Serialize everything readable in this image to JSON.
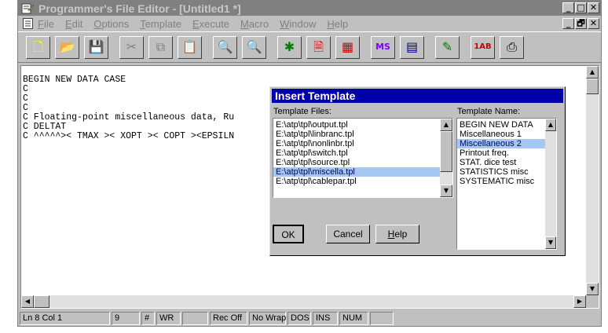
{
  "window": {
    "title": "Programmer's File Editor - [Untitled1 *]",
    "caption_buttons": [
      "_",
      "□",
      "✕"
    ],
    "mdi_buttons": [
      "_",
      "🗗",
      "✕"
    ]
  },
  "menu": [
    "File",
    "Edit",
    "Options",
    "Template",
    "Execute",
    "Macro",
    "Window",
    "Help"
  ],
  "toolbar": [
    {
      "icon": "new-file-icon",
      "glyph": "🗋",
      "color": "#ffff00"
    },
    {
      "icon": "open-folder-icon",
      "glyph": "📂",
      "color": "#ffcc00"
    },
    {
      "icon": "save-icon",
      "glyph": "💾",
      "color": "#cc0000"
    },
    {
      "icon": "cut-icon",
      "glyph": "✂",
      "color": "#808080"
    },
    {
      "icon": "copy-icon",
      "glyph": "⧉",
      "color": "#808080"
    },
    {
      "icon": "paste-icon",
      "glyph": "📋",
      "color": "#808080"
    },
    {
      "icon": "find-icon",
      "glyph": "🔍",
      "color": "#000000"
    },
    {
      "icon": "find-next-icon",
      "glyph": "🔍",
      "color": "#cc0000"
    },
    {
      "icon": "tools-icon",
      "glyph": "✱",
      "color": "#008000"
    },
    {
      "icon": "document-icon",
      "glyph": "🗎",
      "color": "#cc0000"
    },
    {
      "icon": "print-icon",
      "glyph": "▦",
      "color": "#cc0000"
    },
    {
      "icon": "ms-dos-icon",
      "glyph": "MS",
      "color": "#8000ff"
    },
    {
      "icon": "window-list-icon",
      "glyph": "▤",
      "color": "#000080"
    },
    {
      "icon": "pencil-icon",
      "glyph": "✎",
      "color": "#008000"
    },
    {
      "icon": "abc-icon",
      "glyph": "1AB",
      "color": "#cc0000"
    },
    {
      "icon": "printer-icon",
      "glyph": "⎙",
      "color": "#000000"
    }
  ],
  "editor": {
    "lines": [
      "BEGIN NEW DATA CASE",
      "C",
      "C",
      "C",
      "C Floating-point miscellaneous data, Ru",
      "C DELTAT",
      "C ^^^^^>< TMAX >< XOPT >< COPT ><EPSILN"
    ]
  },
  "status": [
    {
      "text": "Ln 8 Col 1",
      "w": 115
    },
    {
      "text": "9",
      "w": 36
    },
    {
      "text": "#",
      "w": 17
    },
    {
      "text": "WR",
      "w": 31
    },
    {
      "text": "",
      "w": 33
    },
    {
      "text": "Rec Off",
      "w": 48
    },
    {
      "text": "No Wrap",
      "w": 47
    },
    {
      "text": "DOS",
      "w": 30
    },
    {
      "text": "INS",
      "w": 32
    },
    {
      "text": "NUM",
      "w": 37
    },
    {
      "text": "",
      "w": 30
    }
  ],
  "dialog": {
    "title": "Insert Template",
    "files_label": "Template Files:",
    "names_label": "Template Name:",
    "files": [
      "E:\\atp\\tpl\\output.tpl",
      "E:\\atp\\tpl\\linbranc.tpl",
      "E:\\atp\\tpl\\nonlinbr.tpl",
      "E:\\atp\\tpl\\switch.tpl",
      "E:\\atp\\tpl\\source.tpl",
      "E:\\atp\\tpl\\miscella.tpl",
      "E:\\atp\\tpl\\cablepar.tpl"
    ],
    "files_selected_index": 5,
    "names": [
      "BEGIN NEW DATA",
      "Miscellaneous 1",
      "Miscellaneous 2",
      "Printout freq.",
      "STAT. dice test",
      "STATISTICS misc",
      "SYSTEMATIC misc"
    ],
    "names_selected_index": 2,
    "ok_label": "OK",
    "cancel_label": "Cancel",
    "help_label": "Help"
  },
  "colors": {
    "dialog_title": "#0000aa",
    "selection": "#a6c8f0",
    "face": "#c0c0c0"
  }
}
